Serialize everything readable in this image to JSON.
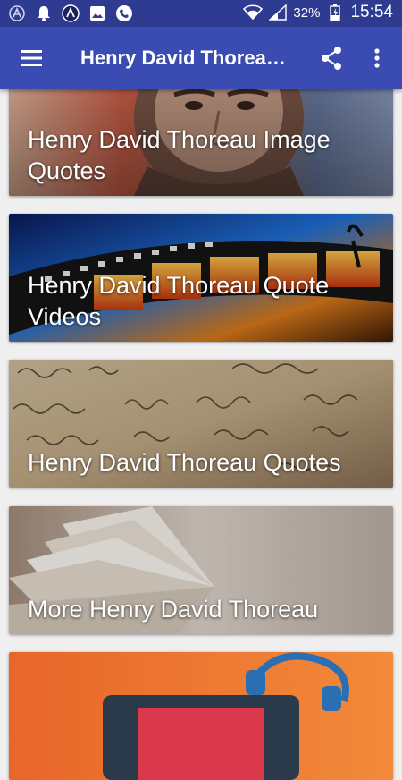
{
  "status_bar": {
    "battery_percent": "32%",
    "time": "15:54",
    "icons": [
      "avast-icon",
      "notification-bell-icon",
      "app-icon",
      "image-icon",
      "phone-icon",
      "wifi-icon",
      "signal-icon",
      "battery-charging-icon"
    ]
  },
  "app_bar": {
    "title": "Henry David Thoreau Quotes",
    "menu_icon": "hamburger-menu-icon",
    "share_icon": "share-icon",
    "more_icon": "more-vertical-icon"
  },
  "cards": [
    {
      "label": "Henry David Thoreau Image Quotes"
    },
    {
      "label": "Henry David Thoreau Quote Videos"
    },
    {
      "label": "Henry David Thoreau Quotes"
    },
    {
      "label": "More Henry David Thoreau"
    },
    {
      "label": ""
    }
  ],
  "colors": {
    "status_bar": "#2f3a91",
    "app_bar": "#3a4bb2",
    "background": "#efefef"
  }
}
